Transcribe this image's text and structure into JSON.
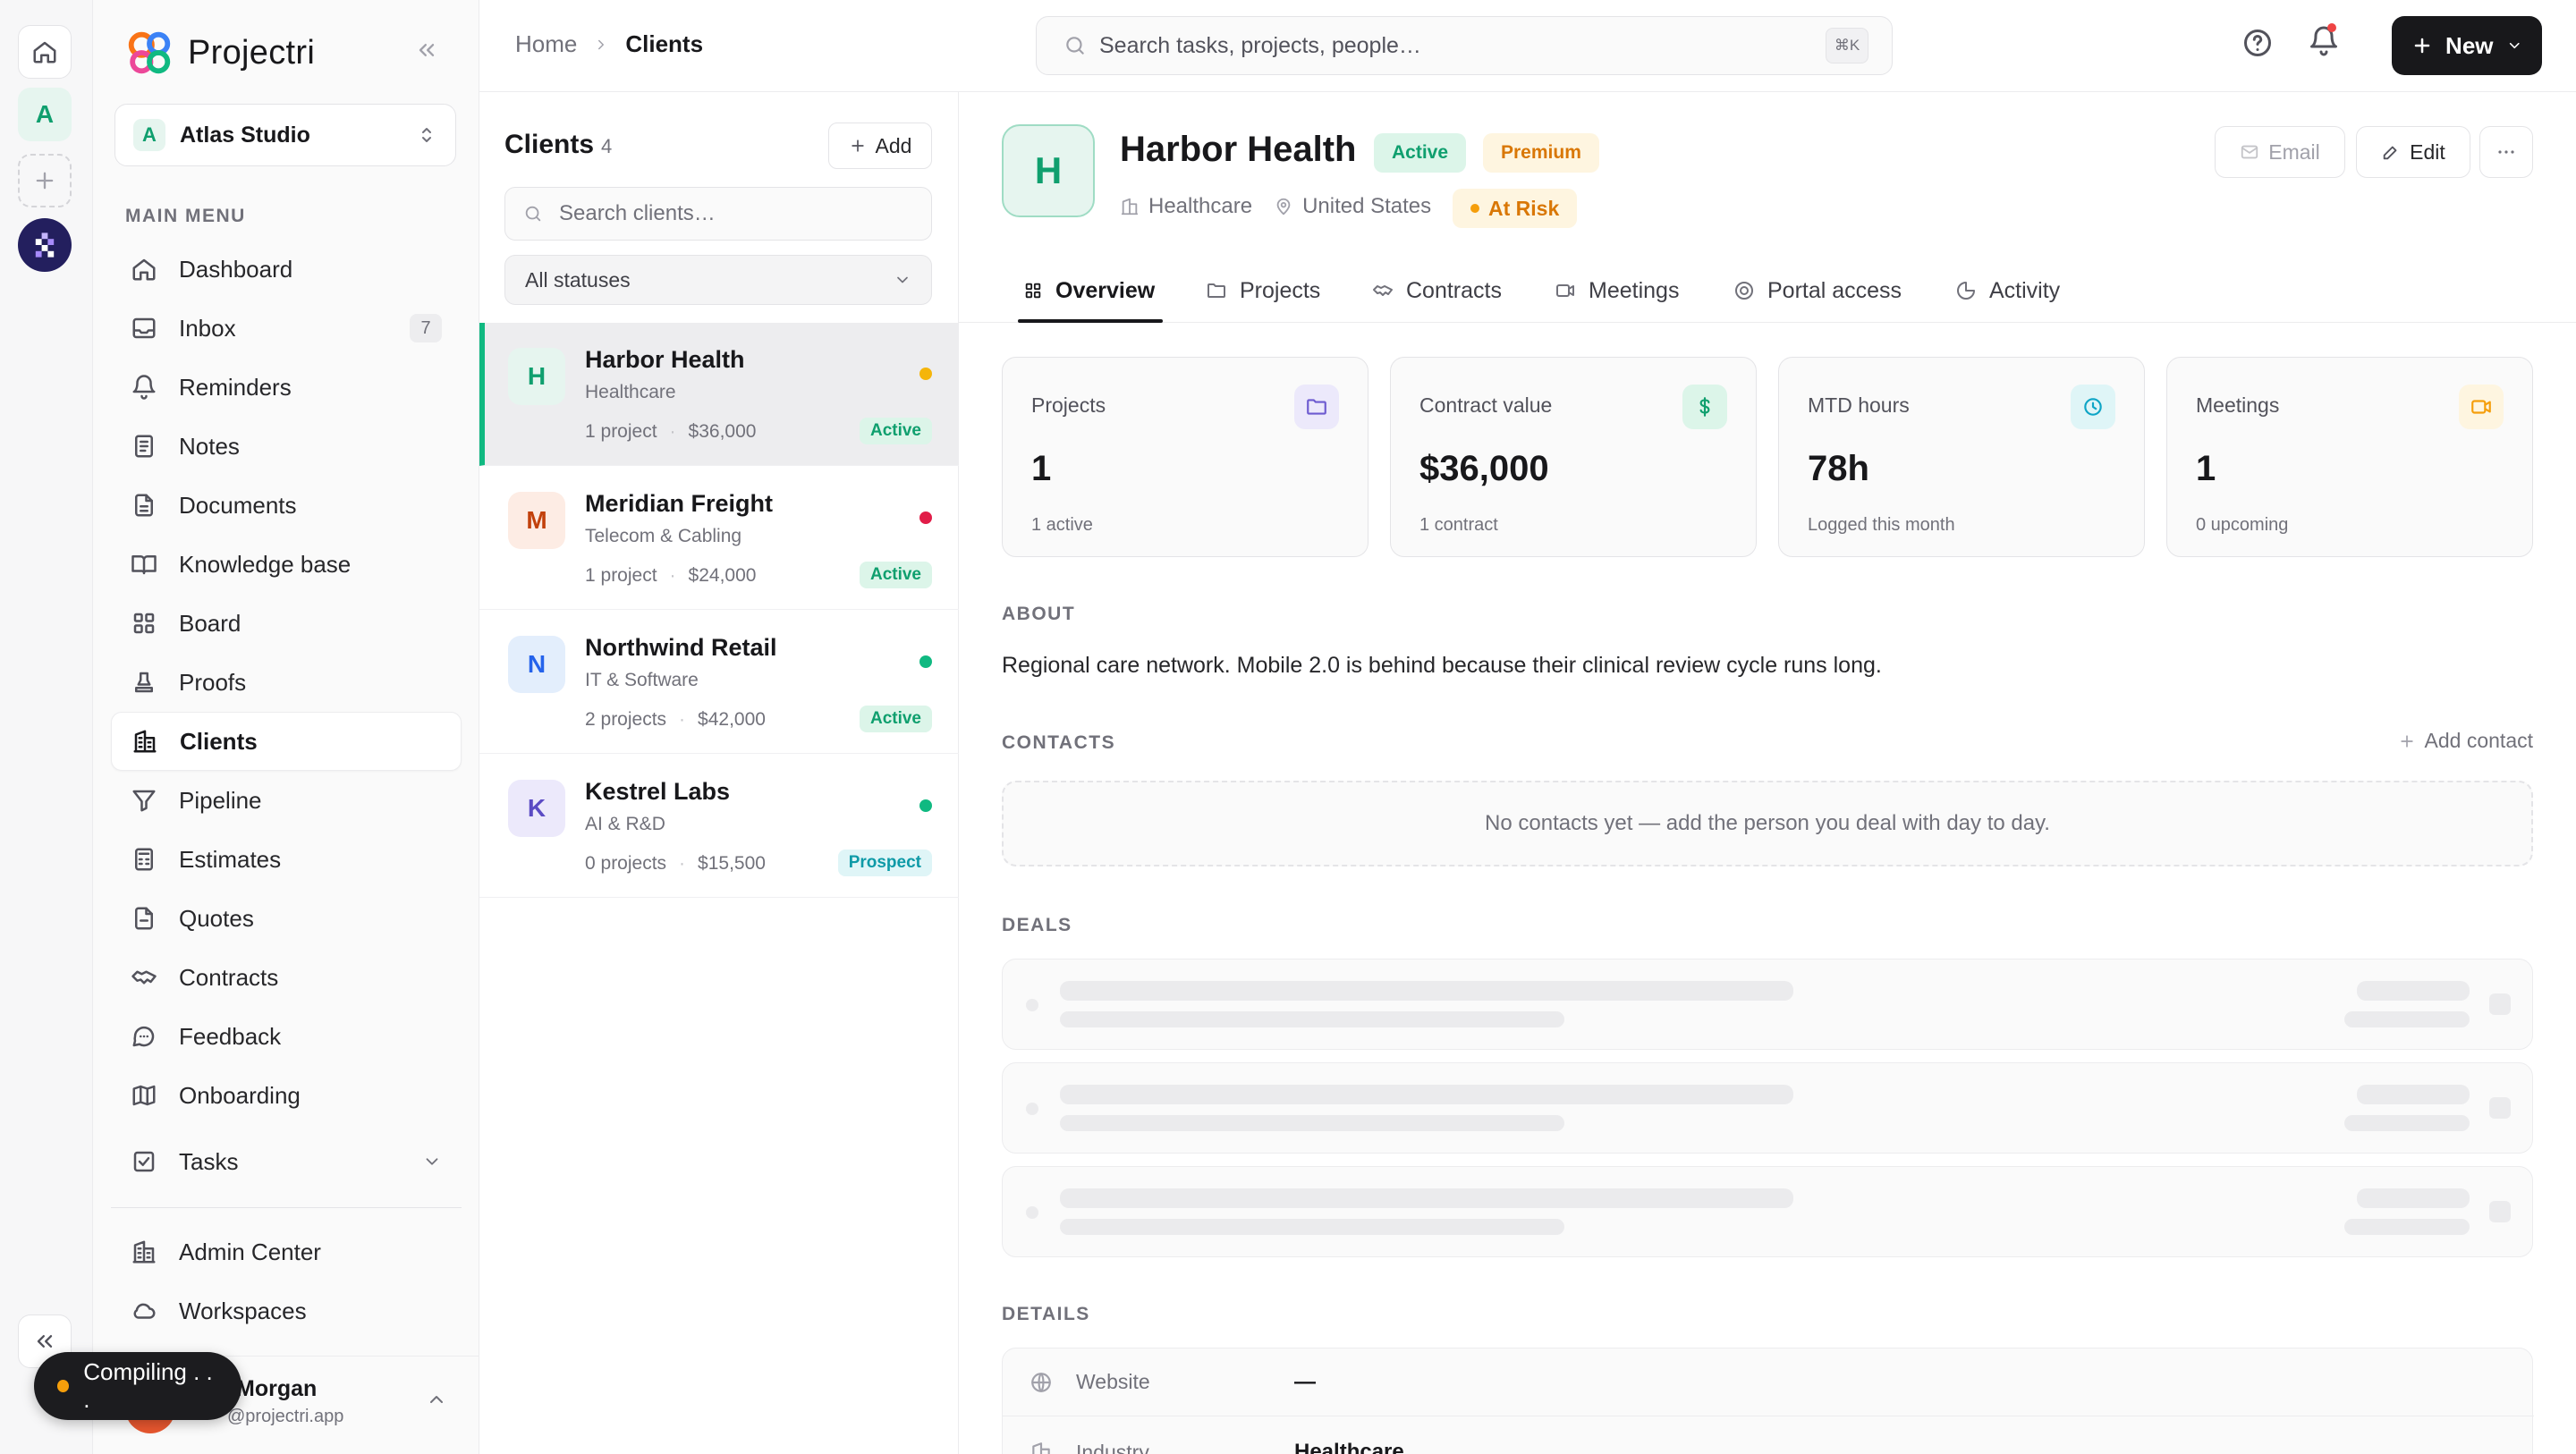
{
  "brand": {
    "name": "Projectri"
  },
  "workspace": {
    "initial": "A",
    "name": "Atlas Studio"
  },
  "sidebar": {
    "menu_label": "MAIN MENU",
    "items": [
      {
        "label": "Dashboard",
        "icon": "home-icon"
      },
      {
        "label": "Inbox",
        "icon": "inbox-icon",
        "badge": "7"
      },
      {
        "label": "Reminders",
        "icon": "bell-icon"
      },
      {
        "label": "Notes",
        "icon": "note-icon"
      },
      {
        "label": "Documents",
        "icon": "document-icon"
      },
      {
        "label": "Knowledge base",
        "icon": "book-icon"
      },
      {
        "label": "Board",
        "icon": "grid-icon"
      },
      {
        "label": "Proofs",
        "icon": "stamp-icon"
      },
      {
        "label": "Clients",
        "icon": "building-icon",
        "active": true
      },
      {
        "label": "Pipeline",
        "icon": "funnel-icon"
      },
      {
        "label": "Estimates",
        "icon": "calculator-icon"
      },
      {
        "label": "Quotes",
        "icon": "quote-doc-icon"
      },
      {
        "label": "Contracts",
        "icon": "handshake-icon"
      },
      {
        "label": "Feedback",
        "icon": "chat-icon"
      },
      {
        "label": "Onboarding",
        "icon": "map-icon"
      },
      {
        "label": "Tasks",
        "icon": "checkbox-icon"
      }
    ],
    "bottom_items": [
      {
        "label": "Admin Center",
        "icon": "building-icon"
      },
      {
        "label": "Workspaces",
        "icon": "cloud-icon"
      }
    ],
    "user": {
      "name": "Morgan",
      "email": "@projectri.app"
    }
  },
  "toast": {
    "text": "Compiling . . ."
  },
  "topbar": {
    "breadcrumb_home": "Home",
    "breadcrumb_current": "Clients",
    "search_placeholder": "Search tasks, projects, people…",
    "search_shortcut": "⌘K",
    "new_label": "New"
  },
  "list": {
    "title": "Clients",
    "count": "4",
    "add_label": "Add",
    "search_placeholder": "Search clients…",
    "filter_value": "All statuses",
    "clients": [
      {
        "initial": "H",
        "name": "Harbor Health",
        "industry": "Healthcare",
        "projects": "1 project",
        "value": "$36,000",
        "status": "Active",
        "dot_color": "#f5b50a",
        "av_bg": "#e6f5ef",
        "av_fg": "#0f9f6e",
        "badge_bg": "#dcf5e9",
        "badge_fg": "#0f9f6e"
      },
      {
        "initial": "M",
        "name": "Meridian Freight",
        "industry": "Telecom & Cabling",
        "projects": "1 project",
        "value": "$24,000",
        "status": "Active",
        "dot_color": "#e11d48",
        "av_bg": "#fdece4",
        "av_fg": "#c2410c",
        "badge_bg": "#dcf5e9",
        "badge_fg": "#0f9f6e"
      },
      {
        "initial": "N",
        "name": "Northwind Retail",
        "industry": "IT & Software",
        "projects": "2 projects",
        "value": "$42,000",
        "status": "Active",
        "dot_color": "#10b981",
        "av_bg": "#e3eefc",
        "av_fg": "#2563eb",
        "badge_bg": "#dcf5e9",
        "badge_fg": "#0f9f6e"
      },
      {
        "initial": "K",
        "name": "Kestrel Labs",
        "industry": "AI & R&D",
        "projects": "0 projects",
        "value": "$15,500",
        "status": "Prospect",
        "dot_color": "#10b981",
        "av_bg": "#ece9fb",
        "av_fg": "#5b4bc4",
        "badge_bg": "#dff5f7",
        "badge_fg": "#0e9aa7"
      }
    ]
  },
  "detail": {
    "initial": "H",
    "name": "Harbor Health",
    "status": "Active",
    "tier": "Premium",
    "industry": "Healthcare",
    "country": "United States",
    "risk": "At Risk",
    "actions": {
      "email": "Email",
      "edit": "Edit"
    },
    "tabs": [
      "Overview",
      "Projects",
      "Contracts",
      "Meetings",
      "Portal access",
      "Activity"
    ],
    "stats": [
      {
        "label": "Projects",
        "value": "1",
        "sub": "1 active",
        "icon": "folder-icon",
        "color": "#6d5bd0",
        "bg": "#ece9fb"
      },
      {
        "label": "Contract value",
        "value": "$36,000",
        "sub": "1 contract",
        "icon": "dollar-icon",
        "color": "#0f9f6e",
        "bg": "#dcf5e9"
      },
      {
        "label": "MTD hours",
        "value": "78h",
        "sub": "Logged this month",
        "icon": "clock-icon",
        "color": "#0ea5c6",
        "bg": "#dff5f7"
      },
      {
        "label": "Meetings",
        "value": "1",
        "sub": "0 upcoming",
        "icon": "video-icon",
        "color": "#f59e0b",
        "bg": "#fef5e0"
      }
    ],
    "about_heading": "ABOUT",
    "about_text": "Regional care network. Mobile 2.0 is behind because their clinical review cycle runs long.",
    "contacts_heading": "CONTACTS",
    "add_contact": "Add contact",
    "contacts_empty": "No contacts yet — add the person you deal with day to day.",
    "deals_heading": "DEALS",
    "details_heading": "DETAILS",
    "details": [
      {
        "label": "Website",
        "value": "—",
        "icon": "globe-icon"
      },
      {
        "label": "Industry",
        "value": "Healthcare",
        "icon": "building-icon"
      }
    ]
  }
}
